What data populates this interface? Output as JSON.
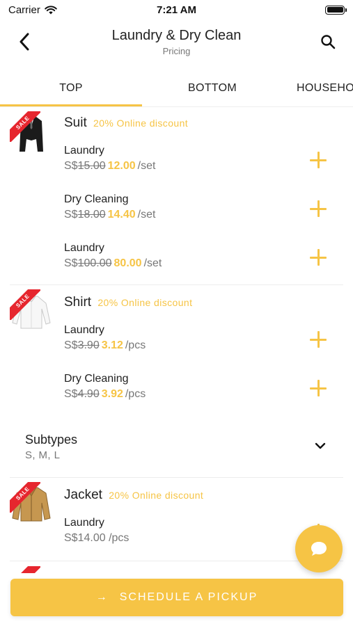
{
  "status_bar": {
    "carrier": "Carrier",
    "time": "7:21 AM"
  },
  "nav": {
    "title": "Laundry & Dry Clean",
    "subtitle": "Pricing"
  },
  "tabs": [
    {
      "label": "TOP",
      "active": true
    },
    {
      "label": "BOTTOM",
      "active": false
    },
    {
      "label": "HOUSEHO",
      "active": false
    }
  ],
  "items": [
    {
      "name": "Suit",
      "discount": "20% Online discount",
      "sale_badge": "SALE",
      "services": [
        {
          "name": "Laundry",
          "currency": "S$",
          "old_price": "15.00",
          "new_price": "12.00",
          "unit": "/set"
        },
        {
          "name": "Dry Cleaning",
          "currency": "S$",
          "old_price": "18.00",
          "new_price": "14.40",
          "unit": "/set"
        },
        {
          "name": "Laundry",
          "currency": "S$",
          "old_price": "100.00",
          "new_price": "80.00",
          "unit": "/set"
        }
      ]
    },
    {
      "name": "Shirt",
      "discount": "20% Online discount",
      "sale_badge": "SALE",
      "services": [
        {
          "name": "Laundry",
          "currency": "S$",
          "old_price": "3.90",
          "new_price": "3.12",
          "unit": "/pcs"
        },
        {
          "name": "Dry Cleaning",
          "currency": "S$",
          "old_price": "4.90",
          "new_price": "3.92",
          "unit": "/pcs"
        }
      ],
      "subtypes": {
        "title": "Subtypes",
        "values": "S, M, L"
      }
    },
    {
      "name": "Jacket",
      "discount": "20% Online discount",
      "sale_badge": "SALE",
      "services": [
        {
          "name": "Laundry",
          "price": "S$14.00",
          "unit": "/pcs"
        }
      ]
    }
  ],
  "cta": {
    "label": "SCHEDULE A PICKUP",
    "arrow": "→"
  },
  "colors": {
    "accent": "#f6c445",
    "sale": "#e6262e",
    "text": "#222222",
    "muted": "#777777"
  },
  "icons": [
    "back-chevron-icon",
    "search-icon",
    "plus-icon",
    "chevron-down-icon",
    "chat-bubble-icon",
    "arrow-right-icon",
    "wifi-icon",
    "battery-icon"
  ]
}
